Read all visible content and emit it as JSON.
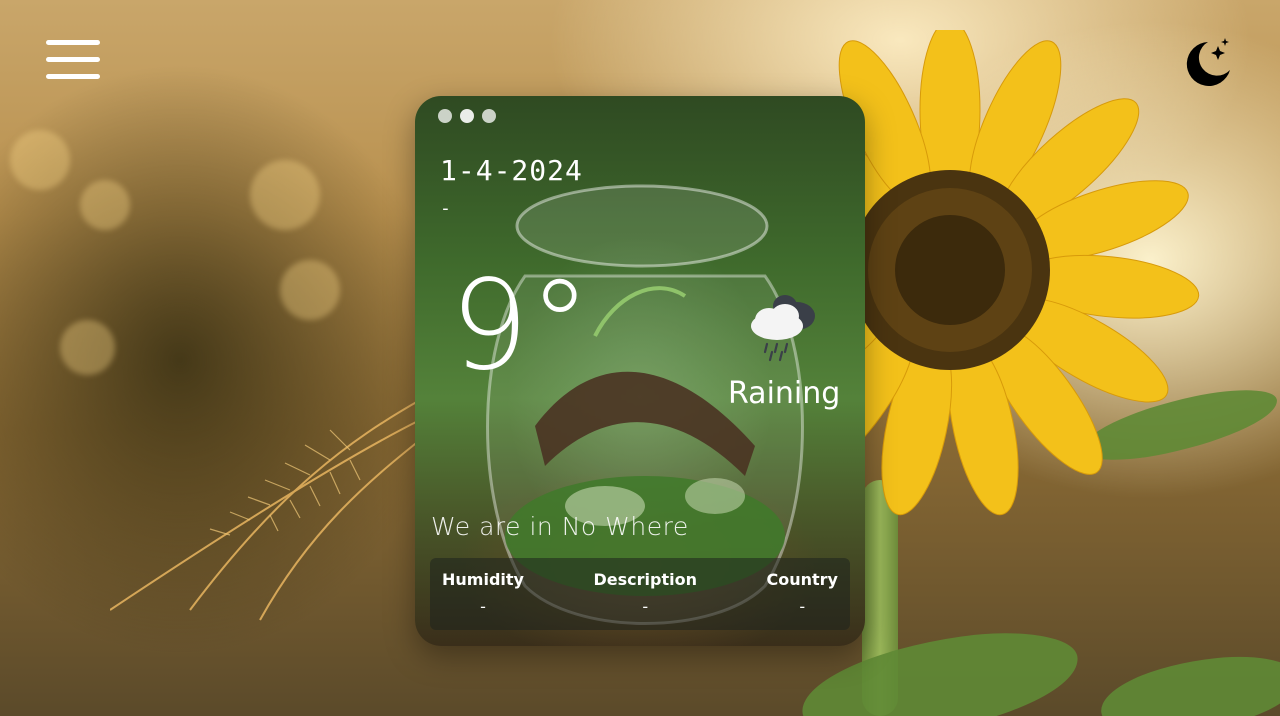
{
  "header": {
    "menu_icon": "hamburger-menu-icon",
    "theme_icon": "moon-stars-icon"
  },
  "card": {
    "window_dots": [
      "dot",
      "dot",
      "dot"
    ],
    "date": "1-4-2024",
    "time": "-",
    "temperature": "9°",
    "weather_icon": "cloud-rain-icon",
    "condition": "Raining",
    "location": "We are in No Where",
    "details": [
      {
        "label": "Humidity",
        "value": "-"
      },
      {
        "label": "Description",
        "value": "-"
      },
      {
        "label": "Country",
        "value": "-"
      }
    ]
  },
  "colors": {
    "text": "#ffffff",
    "details_panel": "#1e231e",
    "theme_icon": "#000000"
  }
}
